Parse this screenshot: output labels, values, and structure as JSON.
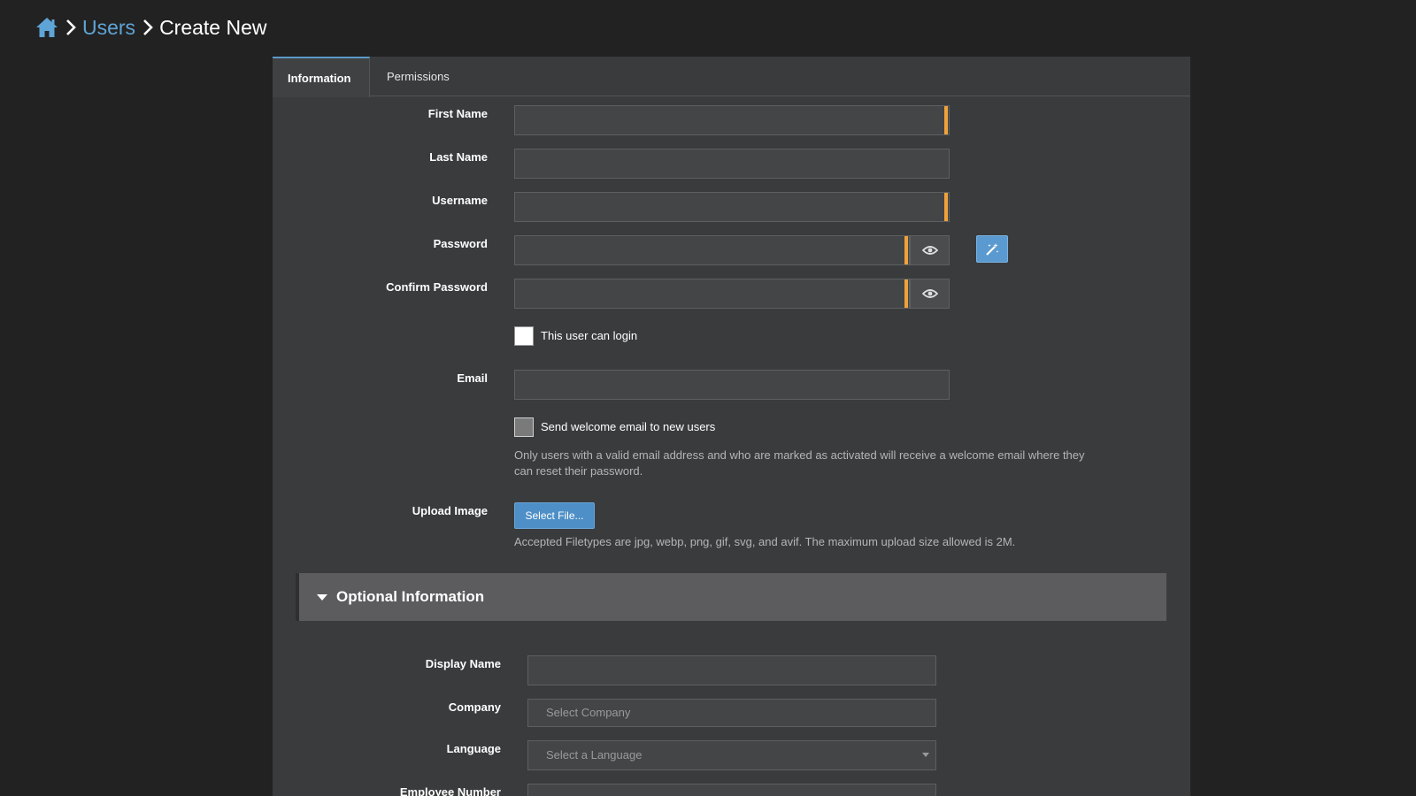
{
  "breadcrumb": {
    "home_icon": "home-icon",
    "users": "Users",
    "current": "Create New"
  },
  "tabs": [
    {
      "label": "Information",
      "active": true
    },
    {
      "label": "Permissions",
      "active": false
    }
  ],
  "form": {
    "first_name": {
      "label": "First Name",
      "value": "",
      "required": true
    },
    "last_name": {
      "label": "Last Name",
      "value": ""
    },
    "username": {
      "label": "Username",
      "value": "",
      "required": true
    },
    "password": {
      "label": "Password",
      "value": "",
      "required": true
    },
    "confirm_password": {
      "label": "Confirm Password",
      "value": "",
      "required": true
    },
    "can_login": {
      "label": "This user can login",
      "checked": false
    },
    "email": {
      "label": "Email",
      "value": ""
    },
    "welcome_email": {
      "label": "Send welcome email to new users",
      "checked": false,
      "help": "Only users with a valid email address and who are marked as activated will receive a welcome email where they can reset their password."
    },
    "upload_image": {
      "label": "Upload Image",
      "button": "Select File...",
      "help": "Accepted Filetypes are jpg, webp, png, gif, svg, and avif. The maximum upload size allowed is 2M."
    }
  },
  "optional": {
    "title": "Optional Information",
    "display_name": {
      "label": "Display Name",
      "value": ""
    },
    "company": {
      "label": "Company",
      "placeholder": "Select Company"
    },
    "language": {
      "label": "Language",
      "placeholder": "Select a Language"
    },
    "employee_number": {
      "label": "Employee Number",
      "value": ""
    }
  },
  "colors": {
    "background": "#222222",
    "panel": "#3a3b3d",
    "accent": "#5a9ad0",
    "required": "#f0a23a",
    "link": "#5fa4d6"
  }
}
